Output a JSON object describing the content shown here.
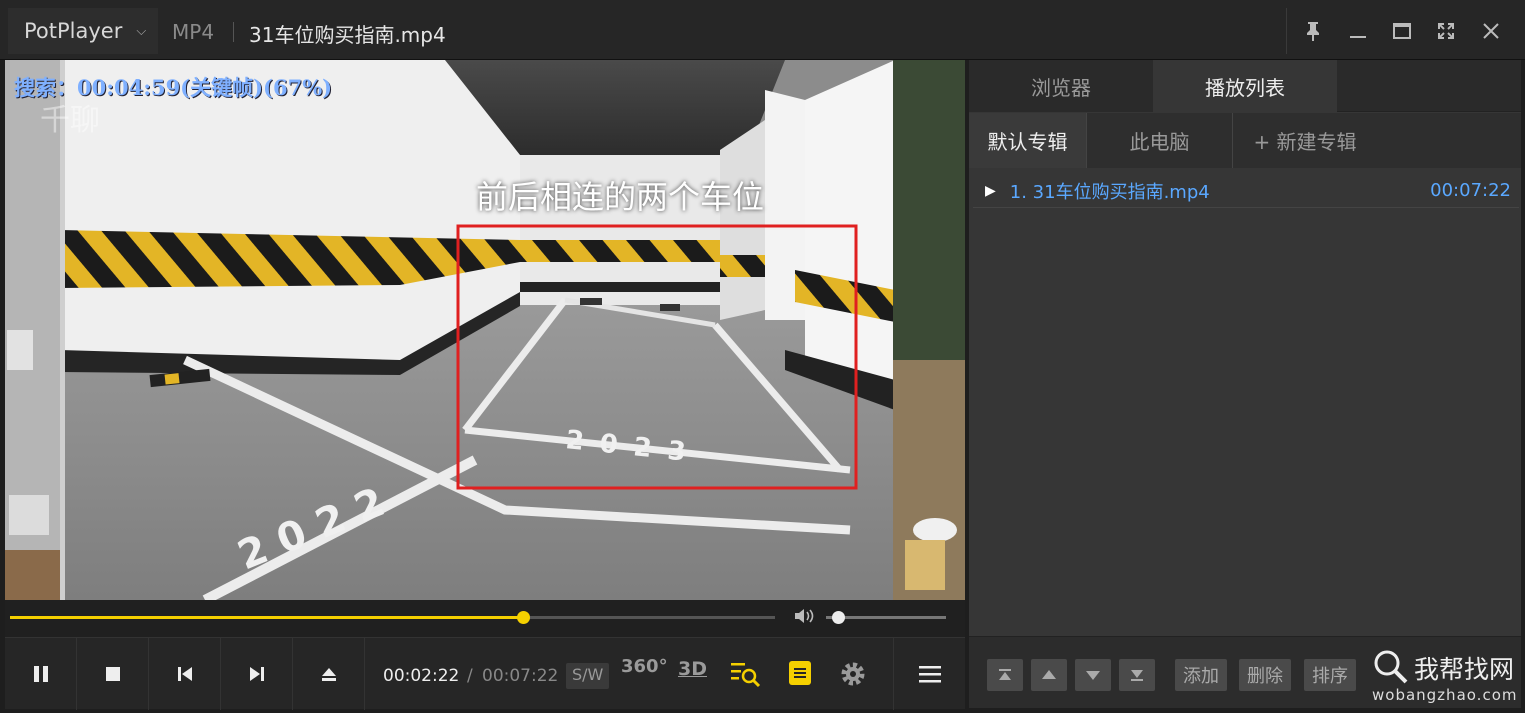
{
  "titlebar": {
    "brand": "PotPlayer",
    "format": "MP4",
    "file_title": "31车位购买指南.mp4"
  },
  "video": {
    "seek_info": "搜索：00:04:59(关键帧)(67%)",
    "watermark": "千聊",
    "caption": "前后相连的两个车位",
    "floor_label_left": "2022",
    "floor_label_right": "2023"
  },
  "seekbar": {
    "progress_percent": 67,
    "volume_percent": 10
  },
  "controls": {
    "time_current": "00:02:22",
    "time_separator": "/",
    "time_total": "00:07:22",
    "sw_label": "S/W",
    "vr_label": "360°",
    "threed_label": "3D"
  },
  "panel": {
    "tabs": [
      "浏览器",
      "播放列表"
    ],
    "subtabs": [
      "默认专辑",
      "此电脑",
      "+ 新建专辑"
    ],
    "playlist": [
      {
        "name": "1. 31车位购买指南.mp4",
        "duration": "00:07:22"
      }
    ],
    "buttons": {
      "add": "添加",
      "delete": "删除",
      "sort": "排序"
    }
  },
  "site_watermark": {
    "name": "我帮找网",
    "url": "wobangzhao.com"
  },
  "colors": {
    "accent": "#f5d000",
    "playlist_text": "#5aa8ff",
    "box": "#e02020"
  }
}
